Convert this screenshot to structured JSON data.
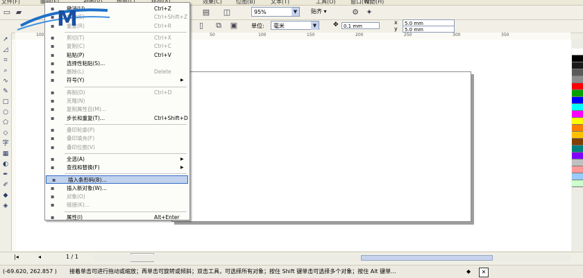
{
  "menubar": [
    "文件(F)",
    "编辑(E)",
    "视图(V)",
    "版面(L)",
    "排列(A)",
    "效果(C)",
    "位图(B)",
    "文本(T)",
    "工具(O)",
    "窗口(W)",
    "帮助(H)"
  ],
  "toolbar": {
    "zoom": "95%",
    "snap": "贴齐",
    "undo_short": "Ctrl+Z"
  },
  "propbar": {
    "unit_label": "单位:",
    "unit": "毫米",
    "nudge": "0.1 mm",
    "dup_x": "5.0 mm",
    "dup_y": "5.0 mm"
  },
  "ruler": {
    "top_labels": [
      "100",
      "50",
      "0",
      "50",
      "100",
      "150",
      "200",
      "250",
      "300",
      "350"
    ]
  },
  "menu": {
    "items": [
      {
        "label": "撤消(U)",
        "shortcut": "Ctrl+Z",
        "state": "normal"
      },
      {
        "label": "重做(E)",
        "shortcut": "Ctrl+Shift+Z",
        "state": "disabled"
      },
      {
        "label": "重复(R)",
        "shortcut": "Ctrl+R",
        "state": "disabled"
      },
      {
        "label": "剪切(T)",
        "shortcut": "Ctrl+X",
        "state": "disabled"
      },
      {
        "label": "复制(C)",
        "shortcut": "Ctrl+C",
        "state": "disabled"
      },
      {
        "label": "粘贴(P)",
        "shortcut": "Ctrl+V",
        "state": "normal"
      },
      {
        "label": "选择性粘贴(S)...",
        "shortcut": "",
        "state": "normal"
      },
      {
        "label": "删除(L)",
        "shortcut": "Delete",
        "state": "disabled"
      },
      {
        "label": "符号(Y)",
        "shortcut": "",
        "state": "normal",
        "submenu": true
      },
      {
        "label": "再制(D)",
        "shortcut": "Ctrl+D",
        "state": "disabled"
      },
      {
        "label": "克隆(N)",
        "shortcut": "",
        "state": "disabled"
      },
      {
        "label": "复制属性自(M)...",
        "shortcut": "",
        "state": "disabled"
      },
      {
        "label": "步长和重复(T)...",
        "shortcut": "Ctrl+Shift+D",
        "state": "normal"
      },
      {
        "label": "叠印轮廓(P)",
        "shortcut": "",
        "state": "disabled"
      },
      {
        "label": "叠印填充(F)",
        "shortcut": "",
        "state": "disabled"
      },
      {
        "label": "叠印位图(V)",
        "shortcut": "",
        "state": "disabled"
      },
      {
        "label": "全选(A)",
        "shortcut": "",
        "state": "normal",
        "submenu": true
      },
      {
        "label": "查找和替换(F)",
        "shortcut": "",
        "state": "normal",
        "submenu": true
      },
      {
        "label": "插入条形码(B)...",
        "shortcut": "",
        "state": "highlighted"
      },
      {
        "label": "插入新对象(W)...",
        "shortcut": "",
        "state": "normal"
      },
      {
        "label": "对象(O)",
        "shortcut": "",
        "state": "disabled"
      },
      {
        "label": "链接(K)...",
        "shortcut": "",
        "state": "disabled"
      },
      {
        "label": "属性(I)",
        "shortcut": "Alt+Enter",
        "state": "normal"
      }
    ]
  },
  "pagenav": {
    "counter": "1 / 1",
    "tab": "页 1"
  },
  "status": {
    "coords": "(-69.620, 262.857 )",
    "message": "接着单击可进行拖动或缩放；再单击可旋转或倾斜；双击工具，可选择所有对象；按住 Shift 键单击可选择多个对象；按住 Alt 键单..."
  },
  "palette": [
    "#ffffff",
    "#000000",
    "#1a1a1a",
    "#5a5a5a",
    "#8c8c8c",
    "#ff0000",
    "#00a000",
    "#0000ff",
    "#00ffff",
    "#ff00ff",
    "#ffff00",
    "#ff8000",
    "#ffc000",
    "#804000",
    "#008080",
    "#8000ff",
    "#c0c0c0",
    "#ff9999",
    "#99ccff",
    "#ccffcc"
  ]
}
